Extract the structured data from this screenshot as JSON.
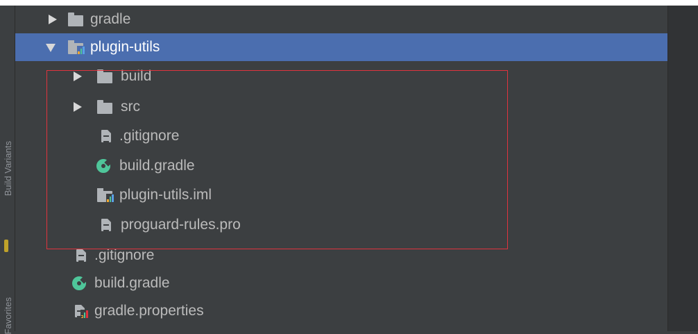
{
  "side_tabs": {
    "build_variants": "Build Variants",
    "favorites": "Favorites"
  },
  "colors": {
    "selection": "#4b6eaf",
    "highlight_box": "#e0343e",
    "background": "#3c3f41",
    "gradle_green": "#4fc69a"
  },
  "tree": [
    {
      "label": "gradle",
      "icon": "folder-icon",
      "expanded": false
    },
    {
      "label": "plugin-utils",
      "icon": "module-folder-icon",
      "expanded": true,
      "selected": true
    },
    {
      "label": "build",
      "icon": "folder-icon",
      "expanded": false
    },
    {
      "label": "src",
      "icon": "folder-icon",
      "expanded": false
    },
    {
      "label": ".gitignore",
      "icon": "text-file-icon"
    },
    {
      "label": "build.gradle",
      "icon": "gradle-icon"
    },
    {
      "label": "plugin-utils.iml",
      "icon": "module-file-icon"
    },
    {
      "label": "proguard-rules.pro",
      "icon": "text-file-icon"
    },
    {
      "label": ".gitignore",
      "icon": "text-file-icon"
    },
    {
      "label": "build.gradle",
      "icon": "gradle-icon"
    },
    {
      "label": "gradle.properties",
      "icon": "properties-file-icon"
    }
  ]
}
